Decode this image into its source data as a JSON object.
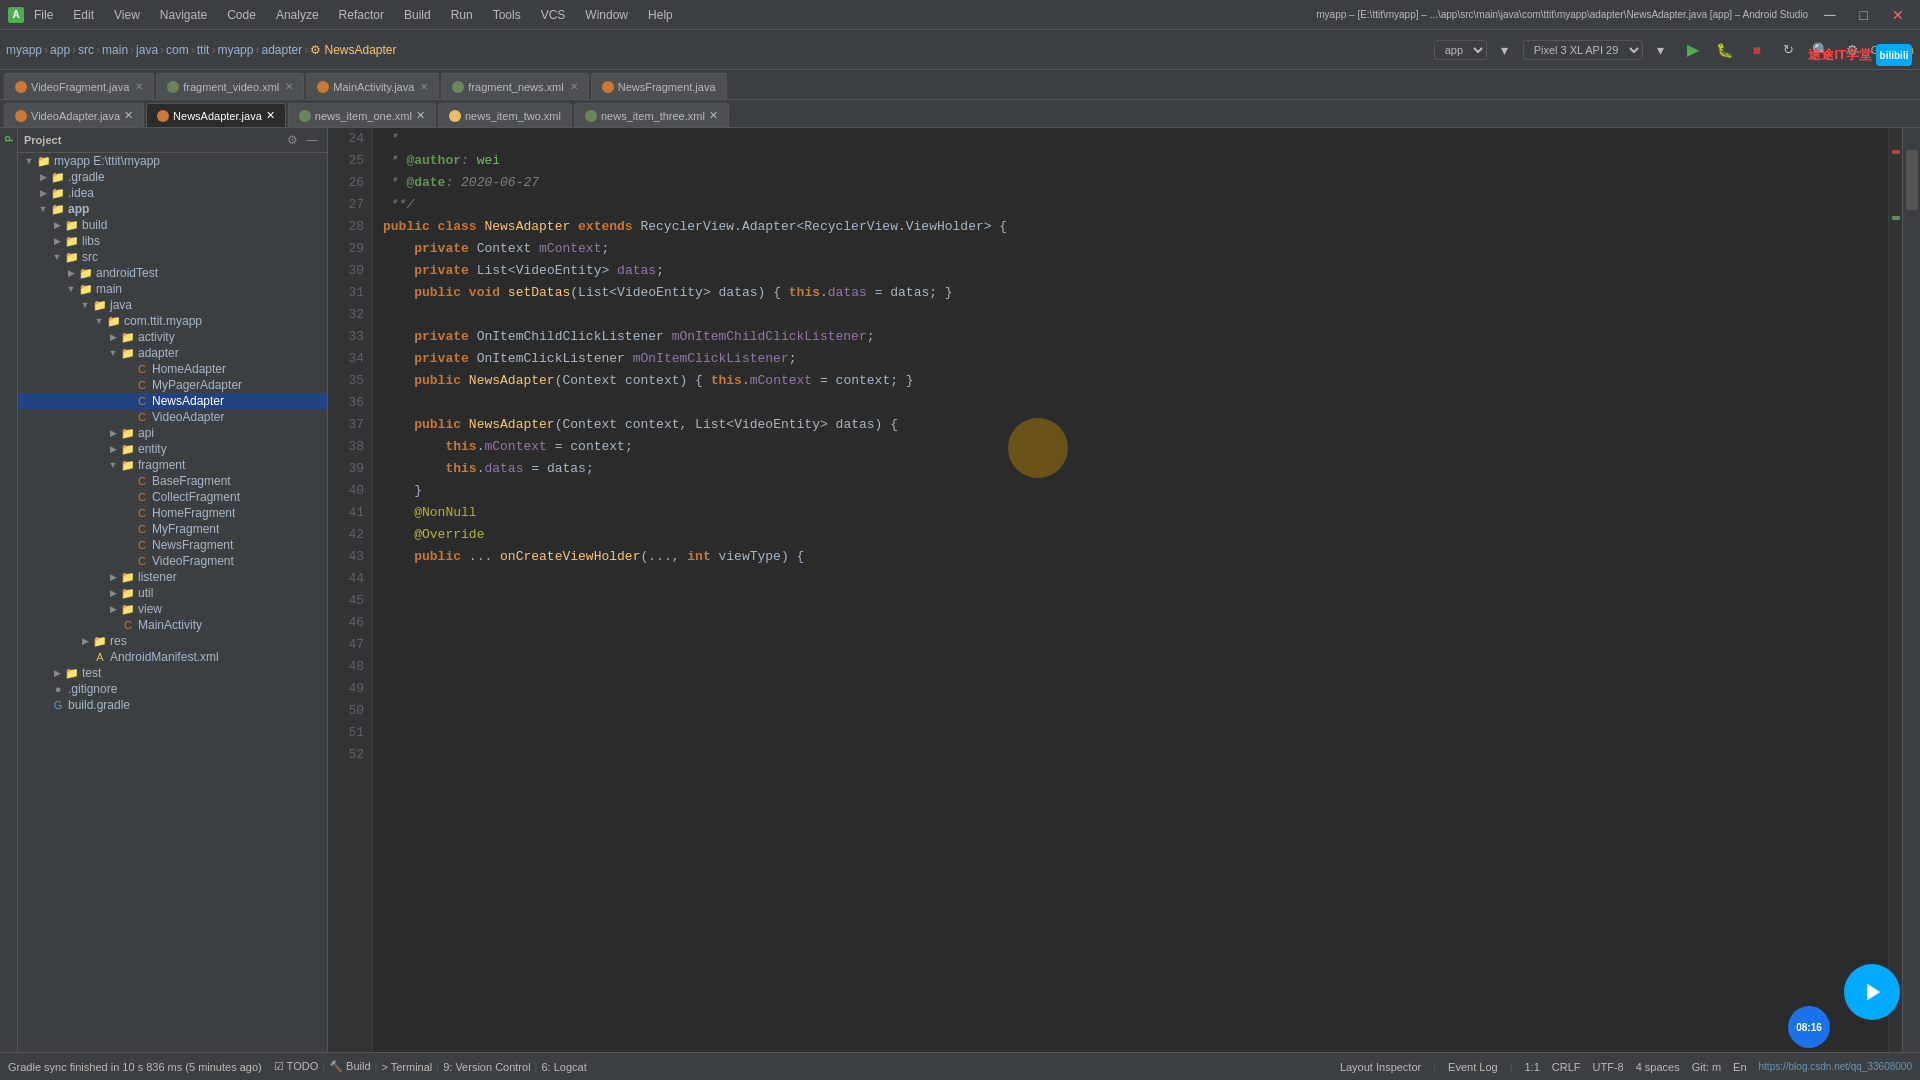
{
  "app": {
    "title": "myapp – [E:\\ttit\\myapp] – ...\\app\\src\\main\\java\\com\\ttit\\myapp\\adapter\\NewsAdapter.java [app] – Android Studio",
    "project_name": "myapp"
  },
  "title_bar": {
    "menus": [
      "File",
      "Edit",
      "View",
      "Navigate",
      "Code",
      "Analyze",
      "Refactor",
      "Build",
      "Run",
      "Tools",
      "VCS",
      "Window",
      "Help"
    ],
    "project_path": "myapp [E:\\ttit\\myapp]",
    "file_path": "...\\app\\src\\main\\java\\com\\ttit\\myapp\\adapter\\NewsAdapter.java [app] – Android Studio"
  },
  "toolbar": {
    "breadcrumbs": [
      "myapp",
      "app",
      "src",
      "main",
      "java",
      "com",
      "ttit",
      "myapp",
      "adapter",
      "NewsAdapter"
    ],
    "device": "Pixel 3 XL API 29",
    "app_target": "app",
    "git_label": "Git:"
  },
  "file_tabs_row1": [
    {
      "name": "VideoFragment.java",
      "icon_color": "#cc7832",
      "active": false,
      "closable": true
    },
    {
      "name": "fragment_video.xml",
      "icon_color": "#6a8759",
      "active": false,
      "closable": true
    },
    {
      "name": "MainActivity.java",
      "icon_color": "#cc7832",
      "active": false,
      "closable": true
    },
    {
      "name": "fragment_news.xml",
      "icon_color": "#6a8759",
      "active": false,
      "closable": true
    },
    {
      "name": "NewsFragment.java",
      "icon_color": "#cc7832",
      "active": false,
      "closable": false
    }
  ],
  "file_tabs_row2": [
    {
      "name": "VideoAdapter.java",
      "icon_color": "#cc7832",
      "active": false,
      "closable": true
    },
    {
      "name": "NewsAdapter.java",
      "icon_color": "#cc7832",
      "active": true,
      "closable": true
    },
    {
      "name": "news_item_one.xml",
      "icon_color": "#6a8759",
      "active": false,
      "closable": true
    },
    {
      "name": "news_item_two.xml",
      "icon_color": "#e8bf6a",
      "active": false,
      "closable": false
    },
    {
      "name": "news_item_three.xml",
      "icon_color": "#6a8759",
      "active": false,
      "closable": true
    }
  ],
  "project_tree": {
    "title": "Project",
    "items": [
      {
        "label": "myapp E:\\ttit\\myapp",
        "depth": 0,
        "type": "project",
        "expanded": true
      },
      {
        "label": ".gradle",
        "depth": 1,
        "type": "folder",
        "expanded": false
      },
      {
        "label": ".idea",
        "depth": 1,
        "type": "folder",
        "expanded": false
      },
      {
        "label": "app",
        "depth": 1,
        "type": "folder",
        "expanded": true
      },
      {
        "label": "build",
        "depth": 2,
        "type": "folder",
        "expanded": false
      },
      {
        "label": "libs",
        "depth": 2,
        "type": "folder",
        "expanded": false
      },
      {
        "label": "src",
        "depth": 2,
        "type": "folder",
        "expanded": true
      },
      {
        "label": "androidTest",
        "depth": 3,
        "type": "folder",
        "expanded": false
      },
      {
        "label": "main",
        "depth": 3,
        "type": "folder",
        "expanded": true
      },
      {
        "label": "java",
        "depth": 4,
        "type": "folder",
        "expanded": true
      },
      {
        "label": "com.ttit.myapp",
        "depth": 5,
        "type": "folder",
        "expanded": true
      },
      {
        "label": "activity",
        "depth": 6,
        "type": "folder",
        "expanded": false
      },
      {
        "label": "adapter",
        "depth": 6,
        "type": "folder",
        "expanded": true
      },
      {
        "label": "HomeAdapter",
        "depth": 7,
        "type": "java",
        "expanded": false
      },
      {
        "label": "MyPagerAdapter",
        "depth": 7,
        "type": "java",
        "expanded": false
      },
      {
        "label": "NewsAdapter",
        "depth": 7,
        "type": "java",
        "selected": true,
        "expanded": false
      },
      {
        "label": "VideoAdapter",
        "depth": 7,
        "type": "java",
        "expanded": false
      },
      {
        "label": "api",
        "depth": 6,
        "type": "folder",
        "expanded": false
      },
      {
        "label": "entity",
        "depth": 6,
        "type": "folder",
        "expanded": false
      },
      {
        "label": "fragment",
        "depth": 6,
        "type": "folder",
        "expanded": true
      },
      {
        "label": "BaseFragment",
        "depth": 7,
        "type": "java",
        "expanded": false
      },
      {
        "label": "CollectFragment",
        "depth": 7,
        "type": "java",
        "expanded": false
      },
      {
        "label": "HomeFragment",
        "depth": 7,
        "type": "java",
        "expanded": false
      },
      {
        "label": "MyFragment",
        "depth": 7,
        "type": "java",
        "expanded": false
      },
      {
        "label": "NewsFragment",
        "depth": 7,
        "type": "java",
        "expanded": false
      },
      {
        "label": "VideoFragment",
        "depth": 7,
        "type": "java",
        "expanded": false
      },
      {
        "label": "listener",
        "depth": 6,
        "type": "folder",
        "expanded": false
      },
      {
        "label": "util",
        "depth": 6,
        "type": "folder",
        "expanded": false
      },
      {
        "label": "view",
        "depth": 6,
        "type": "folder",
        "expanded": false
      },
      {
        "label": "MainActivity",
        "depth": 6,
        "type": "java",
        "expanded": false
      },
      {
        "label": "res",
        "depth": 4,
        "type": "folder",
        "expanded": false
      },
      {
        "label": "AndroidManifest.xml",
        "depth": 4,
        "type": "manifest",
        "expanded": false
      },
      {
        "label": "test",
        "depth": 2,
        "type": "folder",
        "expanded": false
      },
      {
        "label": ".gitignore",
        "depth": 1,
        "type": "file",
        "expanded": false
      },
      {
        "label": "build.gradle",
        "depth": 1,
        "type": "gradle",
        "expanded": false
      }
    ]
  },
  "code": {
    "lines": [
      {
        "num": 24,
        "content": " * "
      },
      {
        "num": 25,
        "content": " * @author: wei"
      },
      {
        "num": 26,
        "content": " * @date: 2020-06-27"
      },
      {
        "num": 27,
        "content": " **/"
      },
      {
        "num": 28,
        "content": "public class NewsAdapter extends RecyclerView.Adapter<RecyclerView.ViewHolder> {"
      },
      {
        "num": 29,
        "content": ""
      },
      {
        "num": 30,
        "content": "    private Context mContext;"
      },
      {
        "num": 31,
        "content": "    private List<VideoEntity> datas;"
      },
      {
        "num": 32,
        "content": ""
      },
      {
        "num": 33,
        "content": "    public void setDatas(List<VideoEntity> datas) { this.datas = datas; }"
      },
      {
        "num": 34,
        "content": ""
      },
      {
        "num": 35,
        "content": "    "
      },
      {
        "num": 36,
        "content": ""
      },
      {
        "num": 37,
        "content": "    private OnItemChildClickListener mOnItemChildClickListener;"
      },
      {
        "num": 38,
        "content": ""
      },
      {
        "num": 39,
        "content": "    private OnItemClickListener mOnItemClickListener;"
      },
      {
        "num": 40,
        "content": ""
      },
      {
        "num": 41,
        "content": "    public NewsAdapter(Context context) { this.mContext = context; }"
      },
      {
        "num": 42,
        "content": ""
      },
      {
        "num": 43,
        "content": "    "
      },
      {
        "num": 44,
        "content": ""
      },
      {
        "num": 45,
        "content": "    public NewsAdapter(Context context, List<VideoEntity> datas) {"
      },
      {
        "num": 46,
        "content": "        this.mContext = context;"
      },
      {
        "num": 47,
        "content": "        this.datas = datas;"
      },
      {
        "num": 48,
        "content": "    }"
      },
      {
        "num": 49,
        "content": ""
      },
      {
        "num": 50,
        "content": "    @NonNull"
      },
      {
        "num": 51,
        "content": "    @Override"
      },
      {
        "num": 52,
        "content": "    public ... onCreateViewHolder(..., int viewType) {"
      }
    ]
  },
  "status_bar": {
    "todo_label": "TODO",
    "build_label": "Build",
    "terminal_label": "Terminal",
    "vc_label": "9: Version Control",
    "logcat_label": "6: Logcat",
    "cursor_pos": "1:1",
    "line_ending": "CRLF",
    "encoding": "UTF-8",
    "indent": "4 spaces",
    "git_m": "Git: m",
    "gradle_message": "Gradle sync finished in 10 s 836 ms (5 minutes ago)",
    "layout_inspector": "Layout Inspector",
    "event_log": "Event Log",
    "time": "08:16",
    "blog_url": "https://blog.csdn.net/qq_33608000"
  },
  "watermark": {
    "text": "途途IT学堂",
    "bilibili": "bilibili"
  }
}
